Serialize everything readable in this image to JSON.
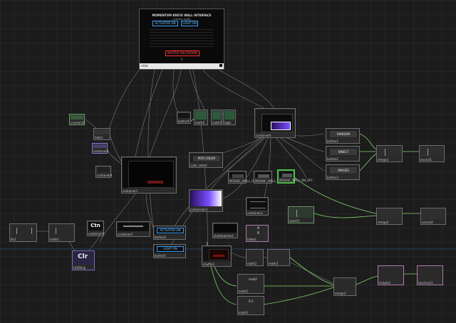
{
  "panel": {
    "title": "MOMENTUM KREYE WALL INTERFACE",
    "subtitle": "CONTROL PANEL",
    "actuator_label": "ACTUATOR ON",
    "light_label": "LIGHT ON",
    "master_label": "MASTER SHUTDOWN",
    "out_label": "nOut",
    "out_value": "1"
  },
  "nodes": {
    "constant1": "constant1",
    "fade1": "fade1",
    "container1": "container1",
    "container4": "container4",
    "container5": "container5",
    "button6": "button6",
    "math4": "math4",
    "math5": "math5",
    "logic": "logic",
    "container6": "container6",
    "container7": "container7",
    "container8": "container8",
    "container2": "container2",
    "container3": "container3",
    "button1": "button1",
    "button2": "button2",
    "button3": "button3",
    "button4": "button4",
    "button5": "button5",
    "merge1": "merge1",
    "merge2": "merge2",
    "merge3": "merge3",
    "select1": "select1",
    "select2": "select2",
    "oscout1": "oscout1",
    "oscout2": "oscout2",
    "shuffle1": "shuffle1",
    "math1": "math1",
    "math2": "math2",
    "math3": "math3",
    "table1": "table1",
    "lfo1": "lfo1",
    "chopto1": "chopto1",
    "touchout1": "touchout1",
    "colorpicker1": "colorpicker1",
    "ctn_label": "Ctn",
    "clr_label": "Clr",
    "clr_name": "LEDStrip",
    "random_label": "RANDOM",
    "kinect_label": "KINECT",
    "images_label": "IMAGES",
    "pick_color_label": "PICK COLOR",
    "pick_color_node": "color_select",
    "actuator_on": "ACTUATOR ON",
    "light_on": "LIGHT ON",
    "shutdowntext": "shutdowntext",
    "table_value": "0",
    "table_value2": "6",
    "mult_value": "mult2",
    "mult_value3": "0.5",
    "light_off_label": "MOSAIC_WALL_ON_OFF",
    "light_off_label2": "MOSAIC_WALL_ON_OFF",
    "light_off_label3": "MOSAIC_WALL_ON_OFF"
  },
  "colors": {
    "accent_blue": "#3aa0ff",
    "accent_red": "#ff3030",
    "wire_green": "#7fd36a",
    "wire_gray": "#8a8a8a",
    "purple_node": "#6a4fa0",
    "violet_gradient": "#5a2bd0"
  }
}
